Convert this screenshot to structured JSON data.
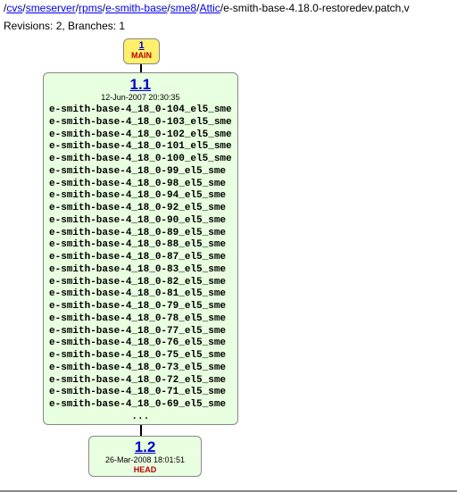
{
  "header": {
    "path_prefix": "/",
    "seg1": "cvs",
    "seg2": "smeserver",
    "seg3": "rpms",
    "seg4": "e-smith-base",
    "seg5": "sme8",
    "seg6": "Attic",
    "filename": "e-smith-base-4.18.0-restoredev.patch,v",
    "revisions_label": "Revisions: ",
    "revisions_value": "2",
    "branches_label": ", Branches: ",
    "branches_value": "1"
  },
  "branch_node": {
    "number": "1",
    "label": "MAIN"
  },
  "rev1": {
    "number": "1.1",
    "date": "12-Jun-2007 20:30:35",
    "tags": [
      "e-smith-base-4_18_0-104_el5_sme",
      "e-smith-base-4_18_0-103_el5_sme",
      "e-smith-base-4_18_0-102_el5_sme",
      "e-smith-base-4_18_0-101_el5_sme",
      "e-smith-base-4_18_0-100_el5_sme",
      "e-smith-base-4_18_0-99_el5_sme",
      "e-smith-base-4_18_0-98_el5_sme",
      "e-smith-base-4_18_0-94_el5_sme",
      "e-smith-base-4_18_0-92_el5_sme",
      "e-smith-base-4_18_0-90_el5_sme",
      "e-smith-base-4_18_0-89_el5_sme",
      "e-smith-base-4_18_0-88_el5_sme",
      "e-smith-base-4_18_0-87_el5_sme",
      "e-smith-base-4_18_0-83_el5_sme",
      "e-smith-base-4_18_0-82_el5_sme",
      "e-smith-base-4_18_0-81_el5_sme",
      "e-smith-base-4_18_0-79_el5_sme",
      "e-smith-base-4_18_0-78_el5_sme",
      "e-smith-base-4_18_0-77_el5_sme",
      "e-smith-base-4_18_0-76_el5_sme",
      "e-smith-base-4_18_0-75_el5_sme",
      "e-smith-base-4_18_0-73_el5_sme",
      "e-smith-base-4_18_0-72_el5_sme",
      "e-smith-base-4_18_0-71_el5_sme",
      "e-smith-base-4_18_0-69_el5_sme"
    ],
    "ellipsis": "..."
  },
  "rev2": {
    "number": "1.2",
    "date": "26-Mar-2008 18:01:51",
    "label": "HEAD"
  }
}
